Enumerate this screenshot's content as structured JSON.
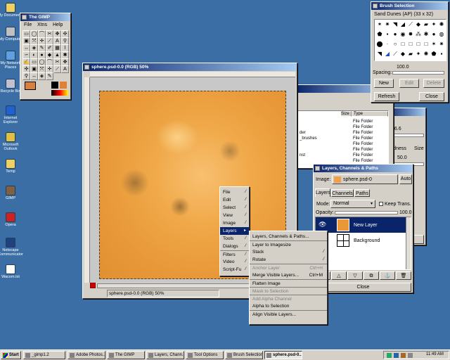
{
  "desktop_icons": [
    {
      "label": "My Documents",
      "color": "#f0d060"
    },
    {
      "label": "My Computer",
      "color": "#c0c0c0"
    },
    {
      "label": "My Network Places",
      "color": "#60a0e0"
    },
    {
      "label": "Recycle Bin",
      "color": "#c0c0d0"
    },
    {
      "label": "Internet Explorer",
      "color": "#2060d0"
    },
    {
      "label": "Microsoft Outlook",
      "color": "#e0c040"
    },
    {
      "label": "Temp",
      "color": "#f0d060"
    },
    {
      "label": "GIMP",
      "color": "#806040"
    },
    {
      "label": "Opera",
      "color": "#d02020"
    },
    {
      "label": "Netscape Communicator",
      "color": "#204080"
    },
    {
      "label": "Wacom.txt",
      "color": "#ffffff"
    }
  ],
  "toolbox": {
    "title": "The GIMP",
    "menus": [
      "File",
      "Xtns",
      "Help"
    ]
  },
  "image_window": {
    "title": "sphere.psd-0.0 (RGB) 50%",
    "status": "sphere.psd-0.0 (RGB) 50%",
    "canvas_color": "#f0a048"
  },
  "context_menu": {
    "items": [
      "File",
      "Edit",
      "Select",
      "View",
      "Image",
      "Layers",
      "Tools",
      "Dialogs",
      "Filters",
      "Video",
      "Script-Fu"
    ]
  },
  "layers_submenu": {
    "items": [
      {
        "label": "Layers, Channels & Paths...",
        "accel": "",
        "enabled": true
      },
      {
        "label": "Layer to Imagesize",
        "accel": "",
        "enabled": true
      },
      {
        "label": "Stack",
        "accel": "",
        "enabled": true
      },
      {
        "label": "Rotate",
        "accel": "",
        "enabled": true
      },
      {
        "label": "Anchor Layer",
        "accel": "Ctrl+H",
        "enabled": false
      },
      {
        "label": "Merge Visible Layers...",
        "accel": "Ctrl+M",
        "enabled": true
      },
      {
        "label": "Flatten Image",
        "accel": "",
        "enabled": true
      },
      {
        "label": "Mask to Selection",
        "accel": "",
        "enabled": false
      },
      {
        "label": "Add Alpha Channel",
        "accel": "",
        "enabled": false
      },
      {
        "label": "Alpha to Selection",
        "accel": "",
        "enabled": true
      },
      {
        "label": "Align Visible Layers...",
        "accel": "",
        "enabled": true
      }
    ]
  },
  "brush_window": {
    "title": "Brush Selection",
    "brush_name": "Sand Dunes (AP)  (33 x 32)",
    "spacing_label": "Spacing:",
    "spacing_value": "100.0",
    "buttons": {
      "new": "New",
      "edit": "Edit",
      "delete": "Delete",
      "refresh": "Refresh",
      "close": "Close"
    }
  },
  "file_window": {
    "columns": [
      "Size",
      "Type"
    ],
    "rows": [
      {
        "name": "",
        "type": "File Folder"
      },
      {
        "name": "",
        "type": "File Folder"
      },
      {
        "name": "der",
        "type": "File Folder"
      },
      {
        "name": "_brushes",
        "type": "File Folder"
      },
      {
        "name": "",
        "type": "File Folder"
      },
      {
        "name": "",
        "type": "File Folder"
      },
      {
        "name": "nst",
        "type": "File Folder"
      },
      {
        "name": "",
        "type": "File Folder"
      },
      {
        "name": "",
        "type": "File Folder"
      }
    ]
  },
  "tool_options": {
    "value1": "86.6",
    "label_ity": "ity",
    "label_hardness": "ardness",
    "label_size": "Size",
    "value2": "50.0",
    "label_se": "se"
  },
  "layers_dialog": {
    "title": "Layers, Channels & Paths",
    "image_label": "Image:",
    "image_value": "sphere.psd-0",
    "auto_label": "Auto",
    "tabs": [
      "Layers",
      "Channels",
      "Paths"
    ],
    "mode_label": "Mode:",
    "mode_value": "Normal",
    "keep_trans": "Keep Trans.",
    "opacity_label": "Opacity:",
    "opacity_value": "100.0",
    "layers": [
      {
        "name": "New Layer",
        "selected": true
      },
      {
        "name": "Background",
        "selected": false
      }
    ],
    "close_label": "Close"
  },
  "taskbar": {
    "start": "Start",
    "items": [
      "_gimp1.2",
      "Adobe Photos...",
      "The GIMP",
      "Layers, Chann...",
      "Tool Options",
      "Brush Selection",
      "sphere.psd-0..."
    ],
    "active_index": 6,
    "clock": "11:49 AM"
  }
}
